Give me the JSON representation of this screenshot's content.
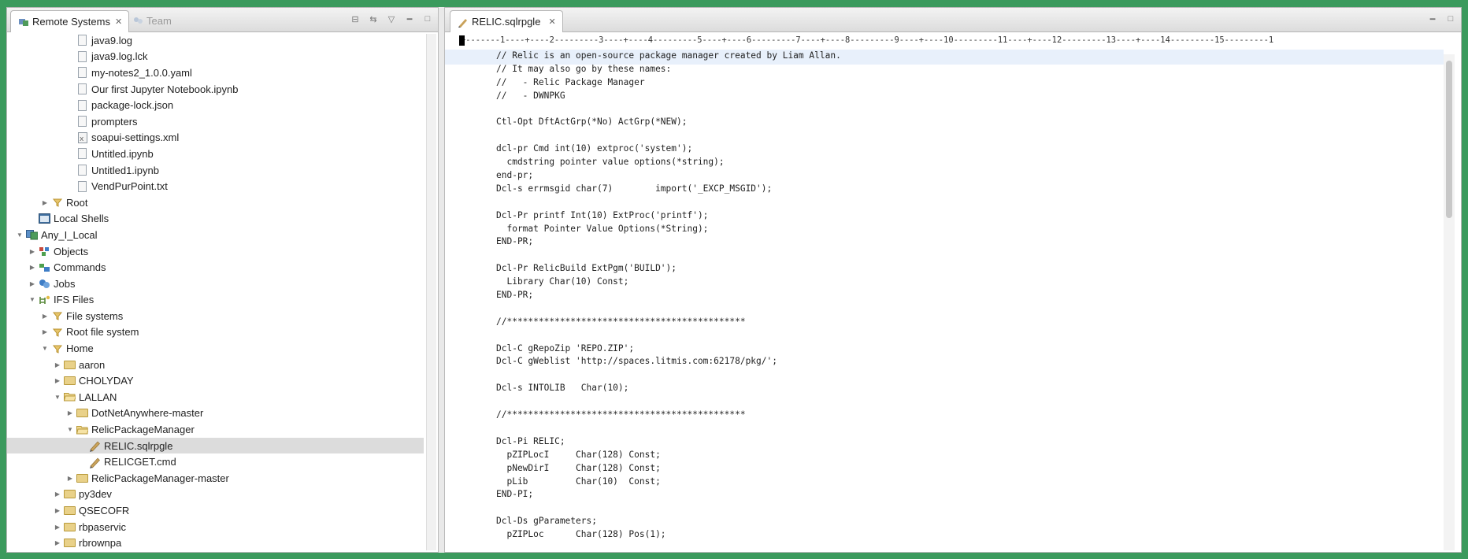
{
  "left_panel": {
    "tabs": [
      {
        "label": "Remote Systems",
        "icon": "remote-systems-icon"
      },
      {
        "label": "Team",
        "icon": "team-icon"
      }
    ],
    "tree": [
      {
        "label": "java9.log",
        "indent": 4,
        "twisty": "none",
        "icon": "file"
      },
      {
        "label": "java9.log.lck",
        "indent": 4,
        "twisty": "none",
        "icon": "file"
      },
      {
        "label": "my-notes2_1.0.0.yaml",
        "indent": 4,
        "twisty": "none",
        "icon": "file"
      },
      {
        "label": "Our first Jupyter Notebook.ipynb",
        "indent": 4,
        "twisty": "none",
        "icon": "file"
      },
      {
        "label": "package-lock.json",
        "indent": 4,
        "twisty": "none",
        "icon": "file"
      },
      {
        "label": "prompters",
        "indent": 4,
        "twisty": "none",
        "icon": "file"
      },
      {
        "label": "soapui-settings.xml",
        "indent": 4,
        "twisty": "none",
        "icon": "xml"
      },
      {
        "label": "Untitled.ipynb",
        "indent": 4,
        "twisty": "none",
        "icon": "file"
      },
      {
        "label": "Untitled1.ipynb",
        "indent": 4,
        "twisty": "none",
        "icon": "file"
      },
      {
        "label": "VendPurPoint.txt",
        "indent": 4,
        "twisty": "none",
        "icon": "file"
      },
      {
        "label": "Root",
        "indent": 2,
        "twisty": "collapsed",
        "icon": "filter"
      },
      {
        "label": "Local Shells",
        "indent": 1,
        "twisty": "none",
        "icon": "shell"
      },
      {
        "label": "Any_I_Local",
        "indent": 0,
        "twisty": "expanded",
        "icon": "system"
      },
      {
        "label": "Objects",
        "indent": 1,
        "twisty": "collapsed",
        "icon": "objects"
      },
      {
        "label": "Commands",
        "indent": 1,
        "twisty": "collapsed",
        "icon": "commands"
      },
      {
        "label": "Jobs",
        "indent": 1,
        "twisty": "collapsed",
        "icon": "jobs"
      },
      {
        "label": "IFS Files",
        "indent": 1,
        "twisty": "expanded",
        "icon": "ifs"
      },
      {
        "label": "File systems",
        "indent": 2,
        "twisty": "collapsed",
        "icon": "filter"
      },
      {
        "label": "Root file system",
        "indent": 2,
        "twisty": "collapsed",
        "icon": "filter"
      },
      {
        "label": "Home",
        "indent": 2,
        "twisty": "expanded",
        "icon": "filter"
      },
      {
        "label": "aaron",
        "indent": 3,
        "twisty": "collapsed",
        "icon": "folder"
      },
      {
        "label": "CHOLYDAY",
        "indent": 3,
        "twisty": "collapsed",
        "icon": "folder"
      },
      {
        "label": "LALLAN",
        "indent": 3,
        "twisty": "expanded",
        "icon": "folder-open"
      },
      {
        "label": "DotNetAnywhere-master",
        "indent": 4,
        "twisty": "collapsed",
        "icon": "folder"
      },
      {
        "label": "RelicPackageManager",
        "indent": 4,
        "twisty": "expanded",
        "icon": "folder-open"
      },
      {
        "label": "RELIC.sqlrpgle",
        "indent": 5,
        "twisty": "none",
        "icon": "source",
        "selected": true
      },
      {
        "label": "RELICGET.cmd",
        "indent": 5,
        "twisty": "none",
        "icon": "source"
      },
      {
        "label": "RelicPackageManager-master",
        "indent": 4,
        "twisty": "collapsed",
        "icon": "folder"
      },
      {
        "label": "py3dev",
        "indent": 3,
        "twisty": "collapsed",
        "icon": "folder"
      },
      {
        "label": "QSECOFR",
        "indent": 3,
        "twisty": "collapsed",
        "icon": "folder"
      },
      {
        "label": "rbpaservic",
        "indent": 3,
        "twisty": "collapsed",
        "icon": "folder"
      },
      {
        "label": "rbrownpa",
        "indent": 3,
        "twisty": "collapsed",
        "icon": "folder"
      }
    ]
  },
  "editor": {
    "tab_label": "RELIC.sqlrpgle",
    "ruler": "+-------1----+----2---------3----+----4---------5----+----6---------7----+----8---------9----+----10---------11----+----12---------13----+----14---------15---------1",
    "code_lines": [
      "// Relic is an open-source package manager created by Liam Allan.",
      "// It may also go by these names:",
      "//   - Relic Package Manager",
      "//   - DWNPKG",
      "",
      "Ctl-Opt DftActGrp(*No) ActGrp(*NEW);",
      "",
      "dcl-pr Cmd int(10) extproc('system');",
      "  cmdstring pointer value options(*string);",
      "end-pr;",
      "Dcl-s errmsgid char(7)        import('_EXCP_MSGID');",
      "",
      "Dcl-Pr printf Int(10) ExtProc('printf');",
      "  format Pointer Value Options(*String);",
      "END-PR;",
      "",
      "Dcl-Pr RelicBuild ExtPgm('BUILD');",
      "  Library Char(10) Const;",
      "END-PR;",
      "",
      "//*********************************************",
      "",
      "Dcl-C gRepoZip 'REPO.ZIP';",
      "Dcl-C gWeblist 'http://spaces.litmis.com:62178/pkg/';",
      "",
      "Dcl-s INTOLIB   Char(10);",
      "",
      "//*********************************************",
      "",
      "Dcl-Pi RELIC;",
      "  pZIPLocI     Char(128) Const;",
      "  pNewDirI     Char(128) Const;",
      "  pLib         Char(10)  Const;",
      "END-PI;",
      "",
      "Dcl-Ds gParameters;",
      "  pZIPLoc      Char(128) Pos(1);"
    ]
  }
}
